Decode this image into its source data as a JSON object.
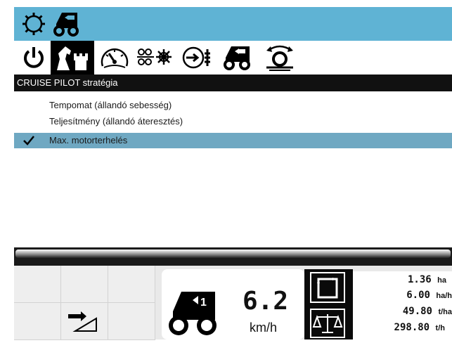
{
  "top_icons": [
    "settings-gear-icon",
    "tractor-icon"
  ],
  "tabs": [
    {
      "name": "power-icon"
    },
    {
      "name": "chess-strategy-icon",
      "selected": true
    },
    {
      "name": "speedometer-icon"
    },
    {
      "name": "threshing-drum-icon"
    },
    {
      "name": "engine-drive-icon"
    },
    {
      "name": "tractor-reverse-icon"
    },
    {
      "name": "header-reel-icon"
    }
  ],
  "panel_title": "CRUISE PILOT stratégia",
  "options": [
    {
      "label": "Tempomat (állandó sebesség)",
      "selected": false
    },
    {
      "label": "Teljesítmény (állandó áteresztés)",
      "selected": false
    },
    {
      "label": "Max. motorterhelés",
      "selected": true
    }
  ],
  "speed": {
    "value": "6.2",
    "unit": "km/h"
  },
  "stats": [
    {
      "value": "1.36",
      "unit": "ha"
    },
    {
      "value": "6.00",
      "unit": "ha/h"
    },
    {
      "value": "49.80",
      "unit": "t/ha"
    },
    {
      "value": "298.80",
      "unit": "t/h"
    }
  ],
  "colors": {
    "top_bar": "#5fb3d4",
    "selected_row": "#6fa8c2",
    "header": "#111111"
  }
}
